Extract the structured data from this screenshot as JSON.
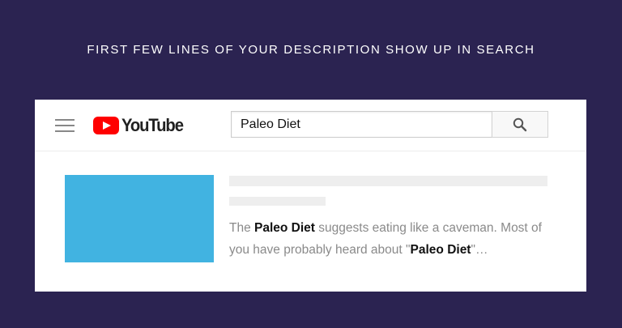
{
  "headline": "FIRST FEW LINES OF YOUR DESCRIPTION SHOW UP IN SEARCH",
  "header": {
    "logo_text": "YouTube",
    "search_value": "Paleo Diet"
  },
  "result": {
    "desc_part1": "The ",
    "desc_bold1": "Paleo Diet",
    "desc_part2": " suggests eating like a caveman. Most of you have probably heard about \"",
    "desc_bold2": "Paleo Diet",
    "desc_part3": "\"…"
  },
  "colors": {
    "background": "#2b2351",
    "youtube_red": "#ff0000",
    "thumbnail": "#41b3e1"
  },
  "icons": {
    "menu": "hamburger-icon",
    "logo": "youtube-play-icon",
    "search": "search-icon"
  }
}
